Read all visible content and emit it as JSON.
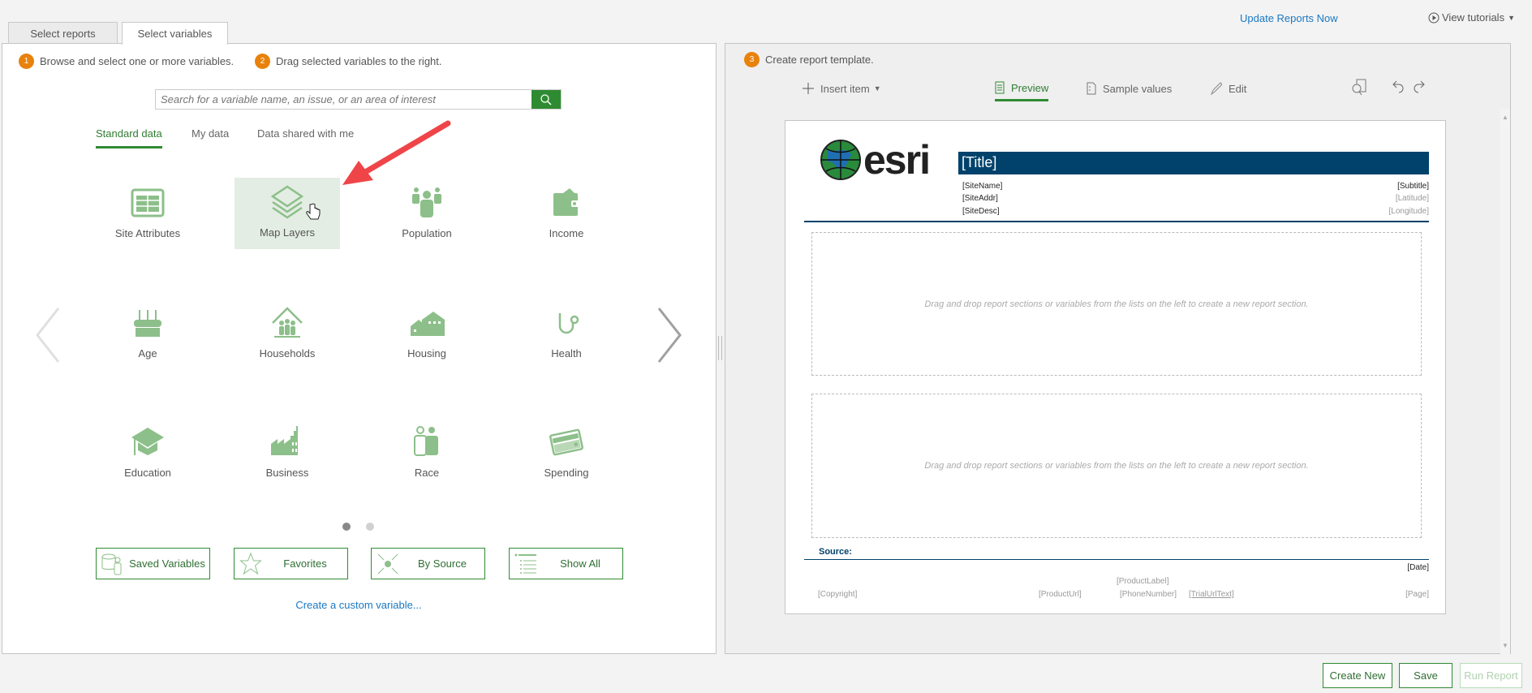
{
  "top": {
    "update_link": "Update Reports Now",
    "tutorials": "View tutorials"
  },
  "tabs": [
    {
      "label": "Select reports"
    },
    {
      "label": "Select variables"
    }
  ],
  "steps": [
    {
      "num": "1",
      "text": "Browse and select one or more variables."
    },
    {
      "num": "2",
      "text": "Drag selected variables to the right."
    },
    {
      "num": "3",
      "text": "Create report template."
    }
  ],
  "search": {
    "placeholder": "Search for a variable name, an issue, or an area of interest"
  },
  "data_tabs": [
    {
      "label": "Standard data"
    },
    {
      "label": "My data"
    },
    {
      "label": "Data shared with me"
    }
  ],
  "categories": [
    {
      "label": "Site Attributes",
      "icon": "table-icon"
    },
    {
      "label": "Map Layers",
      "icon": "layers-icon"
    },
    {
      "label": "Population",
      "icon": "people-icon"
    },
    {
      "label": "Income",
      "icon": "wallet-icon"
    },
    {
      "label": "Age",
      "icon": "cake-icon"
    },
    {
      "label": "Households",
      "icon": "house-family-icon"
    },
    {
      "label": "Housing",
      "icon": "houses-icon"
    },
    {
      "label": "Health",
      "icon": "stethoscope-icon"
    },
    {
      "label": "Education",
      "icon": "graduation-cap-icon"
    },
    {
      "label": "Business",
      "icon": "factory-icon"
    },
    {
      "label": "Race",
      "icon": "two-people-icon"
    },
    {
      "label": "Spending",
      "icon": "credit-card-icon"
    }
  ],
  "pager": {
    "current": 1,
    "total": 2
  },
  "quick": [
    {
      "label": "Saved Variables"
    },
    {
      "label": "Favorites"
    },
    {
      "label": "By Source"
    },
    {
      "label": "Show All"
    }
  ],
  "custom_link": "Create a custom variable...",
  "toolbar": {
    "insert": "Insert item",
    "preview": "Preview",
    "sample": "Sample values",
    "edit": "Edit"
  },
  "report": {
    "logo_text": "esri",
    "title": "[Title]",
    "left": [
      "[SiteName]",
      "[SiteAddr]",
      "[SiteDesc]"
    ],
    "right": [
      "[Subtitle]",
      "[Latitude]",
      "[Longitude]"
    ],
    "drop_text": "Drag and drop report sections or variables from the lists on the left to create a new report section.",
    "source": "Source:",
    "date": "[Date]",
    "product_label": "[ProductLabel]",
    "copyright": "[Copyright]",
    "product_url": "[ProductUrl]",
    "phone": "[PhoneNumber]",
    "trial": "[TrialUrlText]",
    "page": "[Page]"
  },
  "buttons": {
    "create_new": "Create New",
    "save": "Save",
    "run": "Run Report"
  },
  "colors": {
    "accent": "#2f8b31",
    "icon": "#8dbf8a",
    "badge": "#e8820c",
    "title_bar": "#00426b",
    "link": "#1a78c2"
  }
}
